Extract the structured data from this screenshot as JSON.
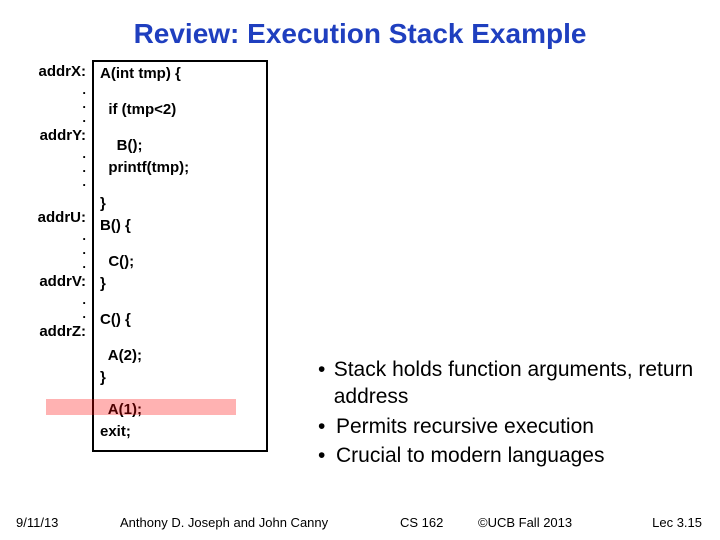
{
  "title": "Review: Execution Stack Example",
  "labels": {
    "addrX": "addrX:",
    "addrY": "addrY:",
    "addrU": "addrU:",
    "addrV": "addrV:",
    "addrZ": "addrZ:",
    "dot": "."
  },
  "code": {
    "l1": "A(int tmp) {",
    "l2": "  if (tmp<2)",
    "l3": "    B();",
    "l4": "  printf(tmp);",
    "l5": "}",
    "l6": "B() {",
    "l7": "  C();",
    "l8": "}",
    "l9": "C() {",
    "l10": "  A(2);",
    "l11": "}",
    "l12": "  A(1);",
    "l13": "exit;"
  },
  "bullets": {
    "b1": "Stack holds function arguments, return address",
    "b2": "Permits recursive execution",
    "b3": "Crucial to modern languages"
  },
  "footer": {
    "date": "9/11/13",
    "authors": "Anthony D. Joseph and John Canny",
    "course": "CS 162",
    "copyright": "©UCB Fall 2013",
    "lec": "Lec 3.15"
  }
}
